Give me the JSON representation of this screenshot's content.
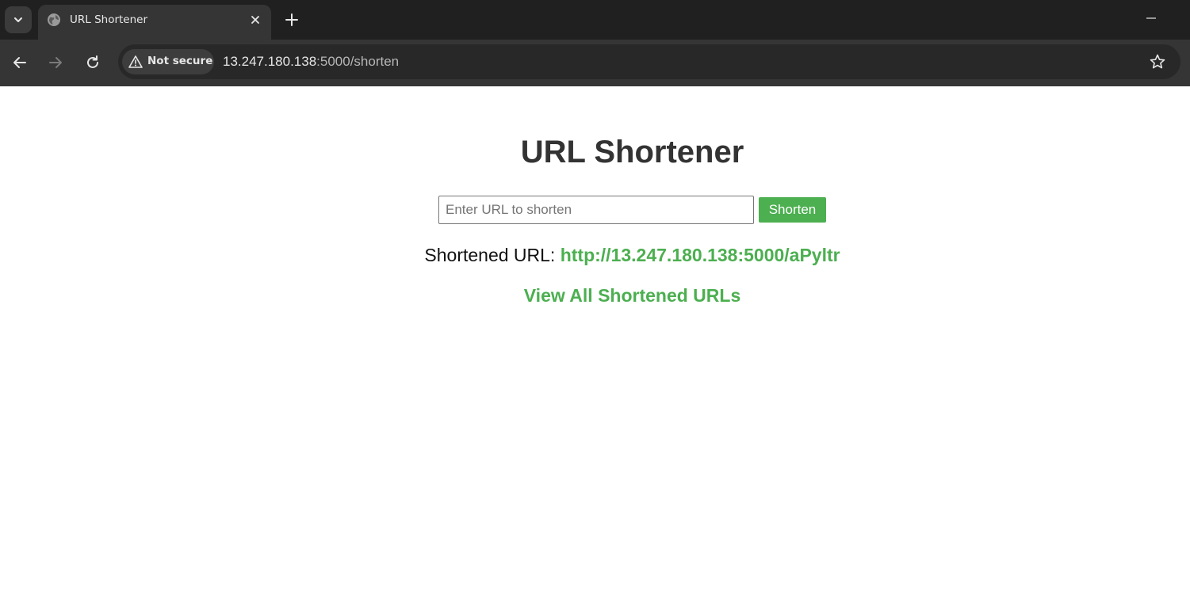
{
  "browser": {
    "tab_title": "URL Shortener",
    "security_label": "Not secure",
    "address_host": "13.247.180.138",
    "address_rest": ":5000/shorten"
  },
  "page": {
    "title": "URL Shortener",
    "input_placeholder": "Enter URL to shorten",
    "input_value": "",
    "shorten_button": "Shorten",
    "result_label": "Shortened URL: ",
    "result_url": "http://13.247.180.138:5000/aPyltr",
    "view_all_link": "View All Shortened URLs"
  },
  "colors": {
    "accent": "#4caf50",
    "title": "#333333",
    "chrome_dark": "#202020",
    "toolbar": "#353535"
  }
}
